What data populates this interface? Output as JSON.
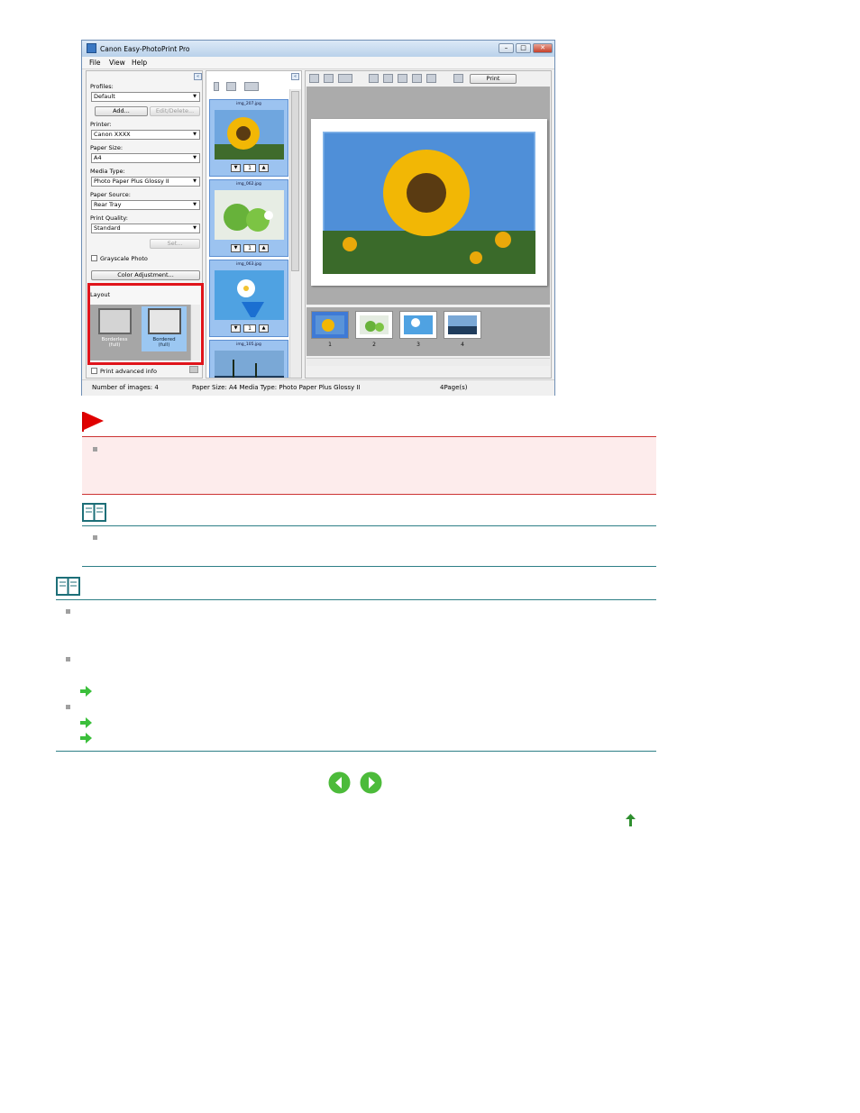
{
  "window": {
    "title": "Canon Easy-PhotoPrint Pro",
    "menu": [
      "File",
      "View",
      "Help"
    ]
  },
  "left_panel": {
    "profiles_label": "Profiles:",
    "profiles_value": "Default",
    "add_button": "Add...",
    "edit_delete_button": "Edit/Delete...",
    "printer_label": "Printer:",
    "printer_value": "Canon XXXX",
    "paper_size_label": "Paper Size:",
    "paper_size_value": "A4",
    "media_type_label": "Media Type:",
    "media_type_value": "Photo Paper Plus Glossy II",
    "paper_source_label": "Paper Source:",
    "paper_source_value": "Rear Tray",
    "print_quality_label": "Print Quality:",
    "print_quality_value": "Standard",
    "set_button": "Set...",
    "grayscale_label": "Grayscale Photo",
    "color_adjust_button": "Color Adjustment...",
    "layout_label": "Layout",
    "layouts": [
      {
        "line1": "Borderless",
        "line2": "(full)"
      },
      {
        "line1": "Bordered",
        "line2": "(full)"
      }
    ],
    "print_advanced_label": "Print advanced info"
  },
  "middle_panel": {
    "photos": [
      {
        "file": "img_207.jpg",
        "count": "1"
      },
      {
        "file": "img_062.jpg",
        "count": "1"
      },
      {
        "file": "img_063.jpg",
        "count": "1"
      },
      {
        "file": "img_105.jpg",
        "count": ""
      }
    ]
  },
  "right_panel": {
    "print_button": "Print",
    "pages": [
      "1",
      "2",
      "3",
      "4"
    ]
  },
  "status": {
    "images": "Number of images: 4",
    "paper": "Paper Size: A4  Media Type: Photo Paper Plus Glossy II",
    "pages": "4Page(s)"
  },
  "colors": {
    "important_bg": "#fdecec",
    "important_border": "#cc3333",
    "note_line": "#2d7f86",
    "arrow_green": "#3bbf3b"
  },
  "icons": [
    "important-flag-icon",
    "note-book-icon",
    "green-arrow-icon",
    "nav-back-icon",
    "nav-forward-icon",
    "page-top-icon"
  ]
}
